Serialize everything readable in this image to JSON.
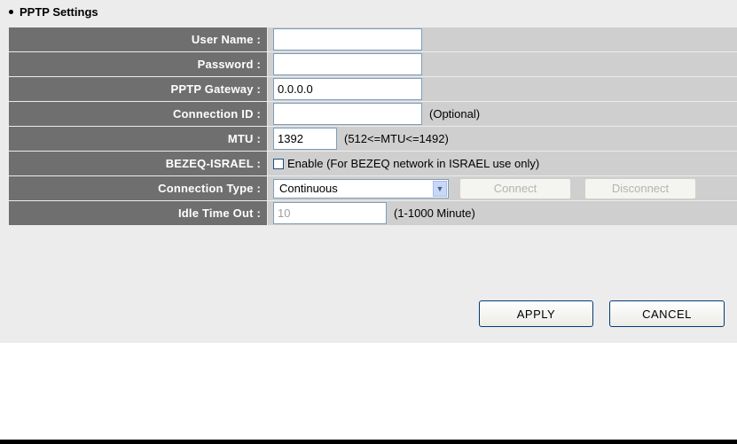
{
  "section": {
    "title": "PPTP Settings"
  },
  "fields": {
    "user_name": {
      "label": "User Name :",
      "value": ""
    },
    "password": {
      "label": "Password :",
      "value": ""
    },
    "pptp_gateway": {
      "label": "PPTP Gateway :",
      "value": "0.0.0.0"
    },
    "connection_id": {
      "label": "Connection ID :",
      "value": "",
      "note": "(Optional)"
    },
    "mtu": {
      "label": "MTU :",
      "value": "1392",
      "note": "(512<=MTU<=1492)"
    },
    "bezeq_israel": {
      "label": "BEZEQ-ISRAEL :",
      "checkbox_label": "Enable (For BEZEQ network in ISRAEL use only)",
      "checked": false
    },
    "connection_type": {
      "label": "Connection Type :",
      "selected": "Continuous",
      "connect_label": "Connect",
      "disconnect_label": "Disconnect"
    },
    "idle_time_out": {
      "label": "Idle Time Out :",
      "value": "10",
      "note": "(1-1000 Minute)"
    }
  },
  "actions": {
    "apply_label": "APPLY",
    "cancel_label": "CANCEL"
  },
  "colors": {
    "label_bg": "#6f6f6f",
    "value_bg": "#cfcfcf",
    "panel_bg": "#ececec"
  },
  "icons": {
    "bullet": "bullet-icon",
    "dropdown": "chevron-down-icon"
  }
}
